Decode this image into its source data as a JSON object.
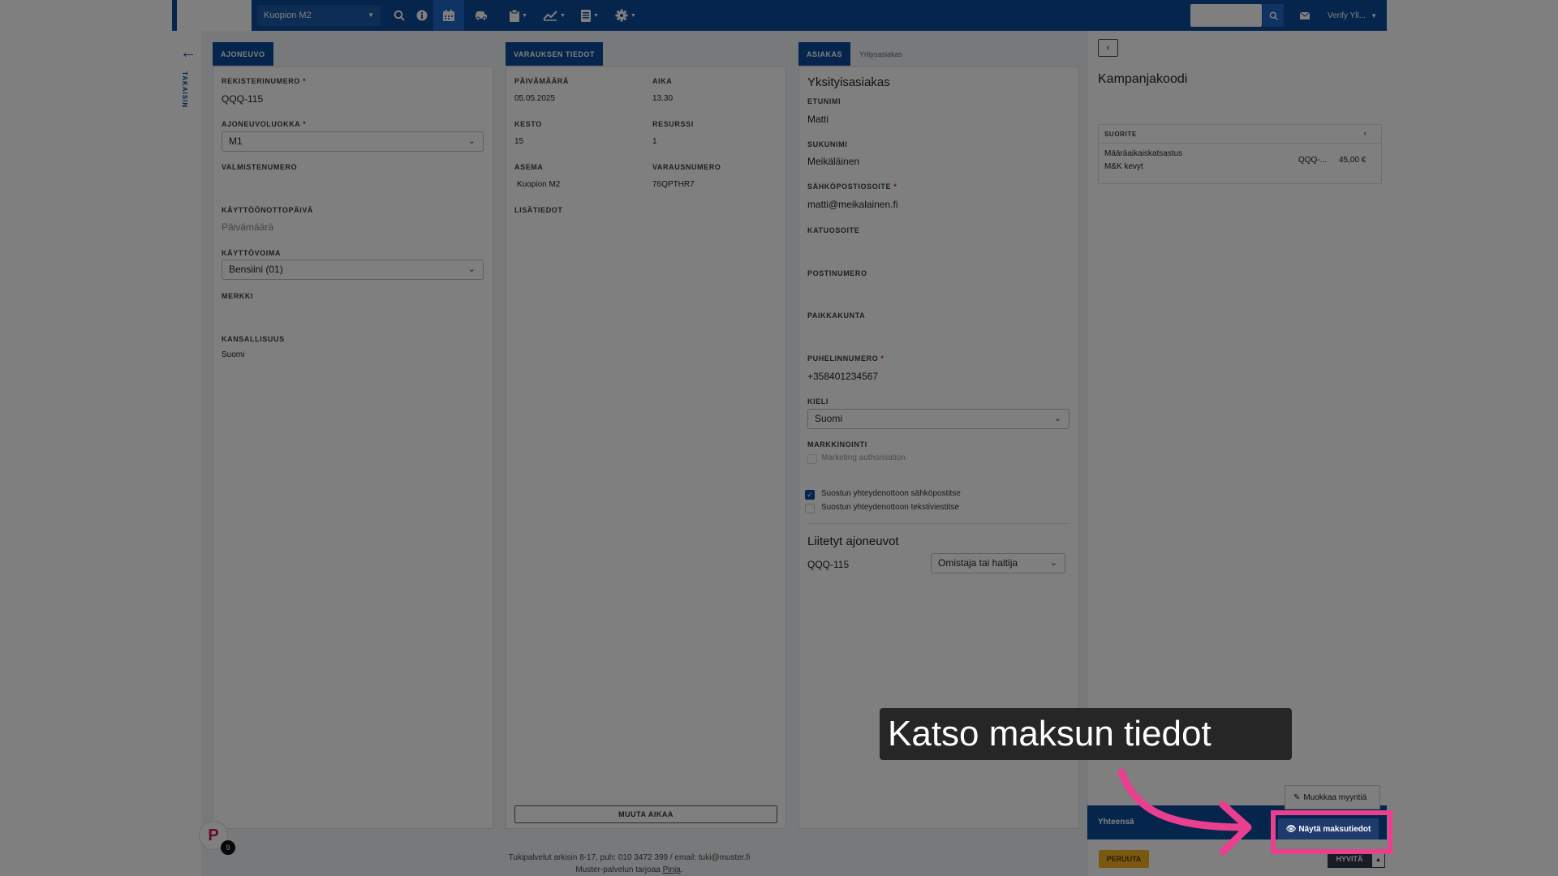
{
  "topbar": {
    "location": "Kuopion M2",
    "user": "Verify Yll..."
  },
  "back": {
    "label": "TAKAISIN"
  },
  "vehicle": {
    "tab": "AJONEUVO",
    "reg_label": "REKISTERINUMERO",
    "reg_value": "QQQ-115",
    "class_label": "AJONEUVOLUOKKA",
    "class_value": "M1",
    "mfg_label": "VALMISTENUMERO",
    "intro_label": "KÄYTTÖÖNOTTOPÄIVÄ",
    "intro_placeholder": "Päivämäärä",
    "fuel_label": "KÄYTTÖVOIMA",
    "fuel_value": "Bensiini (01)",
    "make_label": "MERKKI",
    "nation_label": "KANSALLISUUS",
    "nation_value": "Suomi"
  },
  "booking": {
    "tab": "VARAUKSEN TIEDOT",
    "date_label": "PÄIVÄMÄÄRÄ",
    "date_value": "05.05.2025",
    "time_label": "AIKA",
    "time_value": "13.30",
    "duration_label": "KESTO",
    "duration_value": "15",
    "resource_label": "RESURSSI",
    "resource_value": "1",
    "station_label": "ASEMA",
    "station_value": "Kuopion M2",
    "booking_no_label": "VARAUSNUMERO",
    "booking_no_value": "76QPTHR7",
    "extra_label": "LISÄTIEDOT",
    "change_time_button": "MUUTA AIKAA"
  },
  "customer": {
    "tab_active": "ASIAKAS",
    "tab_other": "Yritysasiakas",
    "type_title": "Yksityisasiakas",
    "first_label": "ETUNIMI",
    "first_value": "Matti",
    "last_label": "SUKUNIMI",
    "last_value": "Meikäläinen",
    "email_label": "SÄHKÖPOSTIOSOITE",
    "email_value": "matti@meikalainen.fi",
    "street_label": "KATUOSOITE",
    "postal_label": "POSTINUMERO",
    "city_label": "PAIKKAKUNTA",
    "phone_label": "PUHELINNUMERO",
    "phone_value": "+358401234567",
    "lang_label": "KIELI",
    "lang_value": "Suomi",
    "marketing_label": "MARKKINOINTI",
    "marketing_auth": "Marketing authorisation",
    "consent_email": "Suostun yhteydenottoon sähköpostitse",
    "consent_sms": "Suostun yhteydenottoon tekstiviestitse",
    "linked_title": "Liitetyt ajoneuvot",
    "linked_reg": "QQQ-115",
    "linked_role": "Omistaja tai haltija"
  },
  "campaign": {
    "title": "Kampanjakoodi",
    "suorite_label": "SUORITE",
    "item_name": "Määräaikaiskatsastus",
    "item_sub": "M&K kevyt",
    "item_reg": "QQQ-...",
    "item_price": "45,00 €",
    "total_label": "Yhteensä",
    "cancel": "PERUUTA",
    "approve": "HYVITÄ",
    "edit_sale": "Muokkaa myyntiä",
    "show_payment": "Näytä maksutiedot"
  },
  "footer": {
    "line1": "Tukipalvelut arkisin 8-17, puh: 010 3472 399 / email: tuki@muster.fi",
    "line2_prefix": "Muster-palvelun tarjoaa ",
    "line2_link": "Pinja",
    "line2_suffix": "."
  },
  "badge": {
    "count": "9"
  },
  "annotation": {
    "callout": "Katso maksun tiedot"
  },
  "colors": {
    "primary": "#0b4a9a",
    "highlight": "#ea3e8f",
    "warning": "#f2b021"
  }
}
